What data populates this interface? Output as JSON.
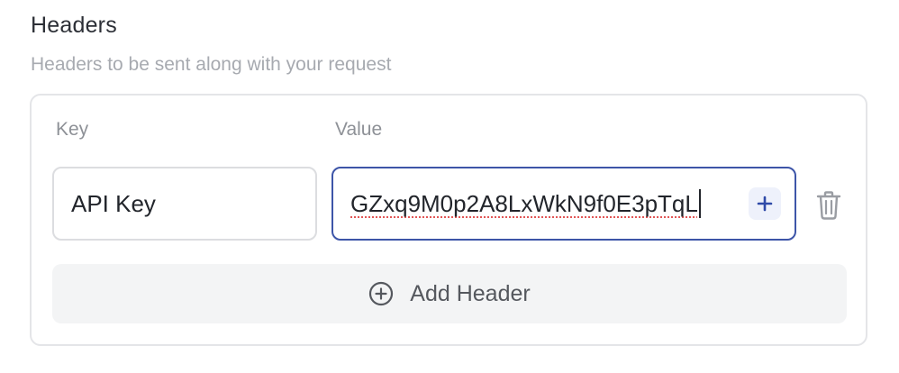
{
  "section": {
    "title": "Headers",
    "subtitle": "Headers to be sent along with your request"
  },
  "columns": {
    "key_label": "Key",
    "value_label": "Value"
  },
  "headers": [
    {
      "key": "API Key",
      "value": "GZxq9M0p2A8LxWkN9f0E3pTqL"
    }
  ],
  "actions": {
    "add_header_label": "Add Header"
  },
  "icons": {
    "insert_variable": "plus-icon",
    "delete_row": "trash-icon",
    "add_header": "plus-circle-icon"
  },
  "colors": {
    "focus_border": "#3d55a8",
    "accent": "#2f4aa8",
    "spellcheck_underline": "#e25656"
  }
}
